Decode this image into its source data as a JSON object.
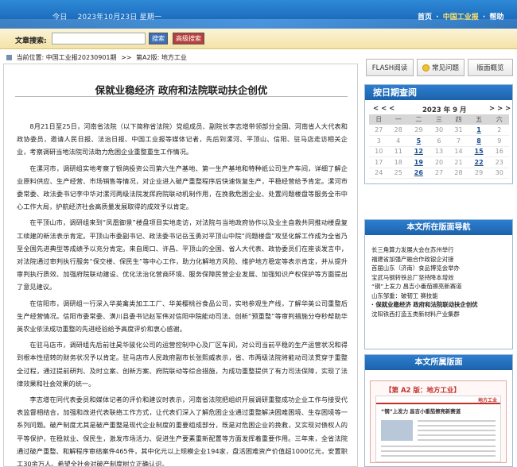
{
  "header": {
    "date_prefix": "今日",
    "date": "2023年10月23日 星期一",
    "nav_home": "首页",
    "nav_sep": "·",
    "nav_site": "中国工业报",
    "nav_help": "帮助"
  },
  "search": {
    "label": "文章搜索:",
    "value": "",
    "search_button": "搜索",
    "advanced_button": "高级搜索"
  },
  "breadcrumb": {
    "prefix": "当前位置:",
    "site": "中国工业报20230901期",
    "sep": ">>",
    "page": "第A2版: 地方工业"
  },
  "article": {
    "title": "保就业稳经济 政府和法院联动扶企创优",
    "paragraphs": [
      "8月21日至25日，河南省法院（以下简称省法院）党组成员、副院长李志增带领部分全国、河南省人大代表和政协委员，邀请人民日报、法治日报、中国工业报等媒体记者，先后到漯河、平顶山、信阳、驻马店走访相关企业，考察调研当地法院司法助力危困企业重整重生工作情况。",
      "在漯河市，调研组实地考察了银鸽投资公司第六生产基地、第一生产基地和特种纸公司生产车间，详细了解企业原料供应、生产经营、市场销售等情况，对企业进入破产重整程序后快速恢复生产，平稳经营给予肯定。漯河市委常委、政法委书记李中华对漯河两级法院发挥府院联动机制作用，在挽救危困企业、处置问题楼盘等服务全市中心工作大局，护航经济社会高质量发展取得的成效予以肯定。",
      "在平顶山市，调研组来到“凤凰御景”楼盘项目实地走访，对法院与当地政府协作以及业主自救共同推动楼盘复工续建的新法表示肯定。平顶山市委副书记、政法委书记岳玉勇对平顶山中院“问题楼盘”攻坚化解工作成为全省乃至全国先进典型等成绩予以充分肯定。来自周口、许昌、平顶山的全国、省人大代表、政协委员们在座谈发言中，对法院通过审判执行服务“保交楼、保民生”等中心工作，助力化解地方风险、维护地方稳定等表示肯定，并从提升审判执行质效、加强府院联动建设、优化法治化营商环境、服务保障民营企业发展、加强知识产权保护等方面提出了意见建议。",
      "在信阳市，调研组一行深入华英禽类加工工厂、华英樱桃谷食品公司，实地参观生产线，了解华英公司重整后生产经营情况。信阳市委常委、潢川县委书记赵军伟对信阳中院能动司法、创新“预重整”等审判措施分夺秒帮助华英农业依法成功重整的先进经验给予高度评价和衷心感谢。",
      "在驻马店市，调研组先后前往昊华骏化公司的运营控制中心及厂区车间，对公司当前平稳的生产运营状况和得到根本性扭转的财务状况予以肯定。驻马店市人民政府副市长张熙威表示，省、市两级法院将能动司法贯穿于重整全过程，通过提前研判、及时立案、创新方案、府院联动等综合措施，为成功重整提供了有力司法保障，实现了法律效果和社会效果的统一。",
      "李志增在同代表委员和媒体记者的评价和建议时表示，河南省法院把组织开展调研重整成功企业工作与接受代表监督相结合，加强和改进代表联络工作方式，让代表们深入了解危困企业通过重整解决困难困境、生存困境等一系列问题。破产制度尤其是破产重整是现代企业制度的重要组成部分，既是对危困企业的挽救，又实现对债权人的平等保护，在稳就业、保民生，激发市场活力、促进生产要素重新配置等方面发挥着重要作用。三年来，全省法院通过破产重整、和解程序审结案件465件，其中化元以上规模企业194家，盘活困难资产价值超1000亿元，安置职工30余万人。希望全社会对破产制度树立正确认识。"
    ]
  },
  "toolbar": {
    "flash_label": "FLASH阅读",
    "faq_label": "常见问题",
    "overview_label": "版面概览"
  },
  "calendar": {
    "title": "按日期查阅",
    "prev": "< < <",
    "month": "2023 年 9 月",
    "next": "> > >",
    "weekdays": [
      "日",
      "一",
      "二",
      "三",
      "四",
      "五",
      "六"
    ],
    "rows": [
      [
        "27",
        "28",
        "29",
        "30",
        "31",
        "1",
        "2"
      ],
      [
        "3",
        "4",
        "5",
        "6",
        "7",
        "8",
        "9"
      ],
      [
        "10",
        "11",
        "12",
        "13",
        "14",
        "15",
        "16"
      ],
      [
        "17",
        "18",
        "19",
        "20",
        "21",
        "22",
        "23"
      ],
      [
        "24",
        "25",
        "26",
        "27",
        "28",
        "29",
        "30"
      ]
    ],
    "issue_days": [
      "1",
      "5",
      "8",
      "12",
      "15",
      "19",
      "22",
      "26"
    ]
  },
  "page_nav": {
    "title": "本文所在版面导航",
    "items": [
      "长三角算力发展大会在苏州举行",
      "福建省加强产融合作政银企对接",
      "首届山东（济南）食品博览会举办",
      "宝武马钢转铁总厂坚持降本增效",
      "“钢”上发力 昌吉小番茄擦亮新赛道",
      "山东邹重：破韧工 赛技能",
      "· 保就业稳经济 政府和法院联动扶企创优",
      "沈阳铁西打造五类新材料产业集群"
    ],
    "current_index": 6
  },
  "layout": {
    "title": "本文所属版面",
    "caption": "【第 A2 版：地方工业】",
    "thumb_masthead": "地方工业",
    "thumb_headline": "“钢”上发力 昌吉小番茄擦亮新赛道"
  }
}
